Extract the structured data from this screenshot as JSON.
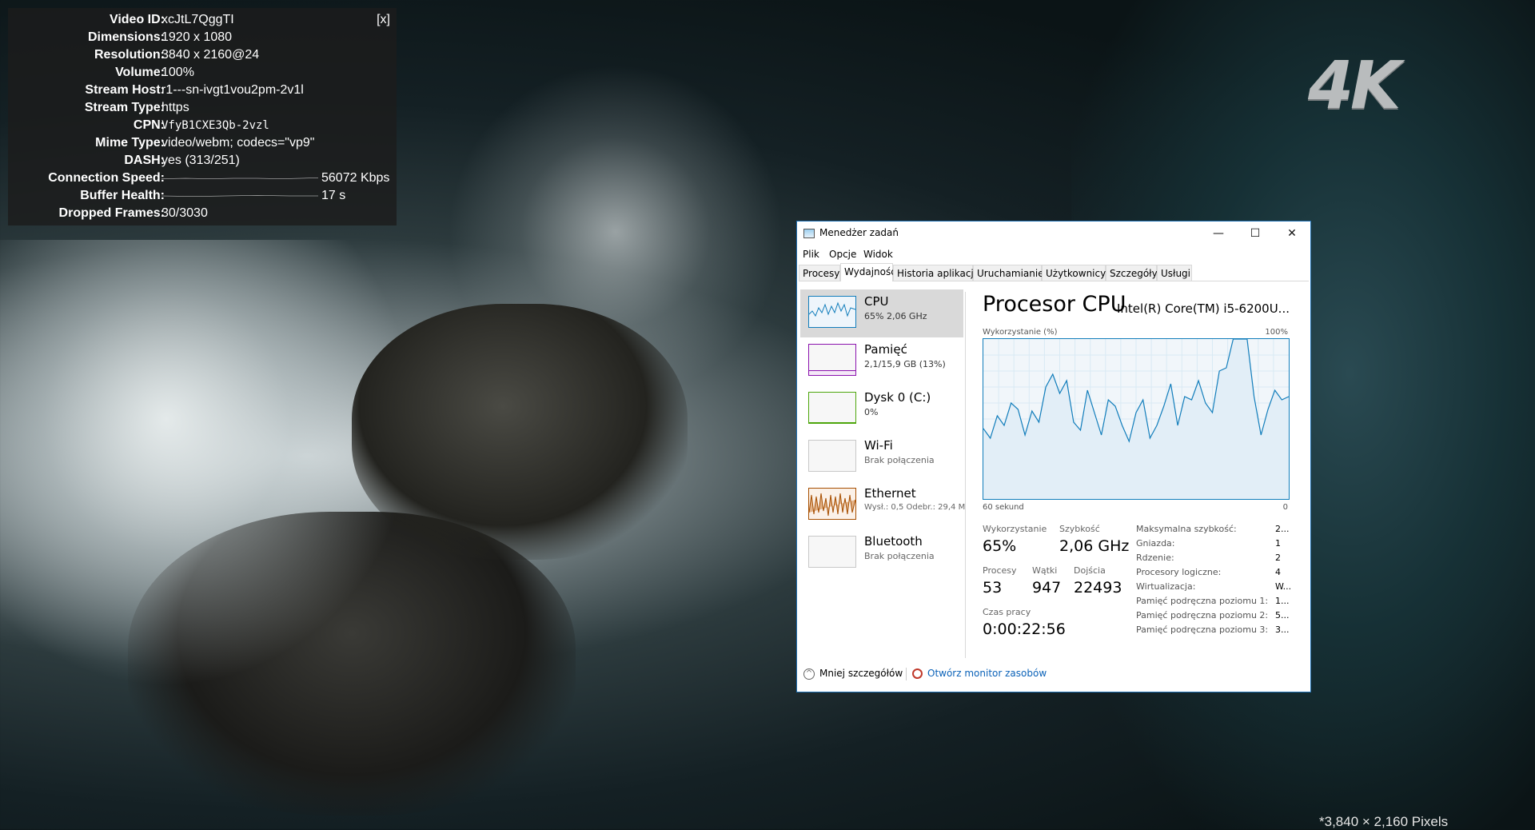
{
  "stats": {
    "close_label": "[x]",
    "rows": [
      {
        "key": "Video ID:",
        "value": "xcJtL7QggTI"
      },
      {
        "key": "Dimensions:",
        "value": "1920 x 1080"
      },
      {
        "key": "Resolution:",
        "value": "3840 x 2160@24"
      },
      {
        "key": "Volume:",
        "value": "100%"
      },
      {
        "key": "Stream Host:",
        "value": "r1---sn-ivgt1vou2pm-2v1l"
      },
      {
        "key": "Stream Type:",
        "value": "https"
      },
      {
        "key": "CPN:",
        "value": "VfyB1CXE3Qb-2vzl"
      },
      {
        "key": "Mime Type:",
        "value": "video/webm; codecs=\"vp9\""
      },
      {
        "key": "DASH:",
        "value": "yes (313/251)"
      },
      {
        "key": "Connection Speed:",
        "value": "56072 Kbps"
      },
      {
        "key": "Buffer Health:",
        "value": "17 s"
      },
      {
        "key": "Dropped Frames:",
        "value": "30/3030"
      }
    ]
  },
  "overlay": {
    "logo": "4K",
    "pixels_note": "*3,840 × 2,160 Pixels"
  },
  "taskmanager": {
    "title": "Menedżer zadań",
    "window_buttons": {
      "minimize": "—",
      "maximize": "☐",
      "close": "✕"
    },
    "menu": [
      "Plik",
      "Opcje",
      "Widok"
    ],
    "tabs": [
      "Procesy",
      "Wydajność",
      "Historia aplikacji",
      "Uruchamianie",
      "Użytkownicy",
      "Szczegóły",
      "Usługi"
    ],
    "active_tab": "Wydajność",
    "resources": [
      {
        "name": "CPU",
        "sub": "65%  2,06 GHz",
        "color": "#117dbb",
        "selected": true
      },
      {
        "name": "Pamięć",
        "sub": "2,1/15,9 GB (13%)",
        "color": "#8b12ae",
        "selected": false
      },
      {
        "name": "Dysk 0 (C:)",
        "sub": "0%",
        "color": "#4da60c",
        "selected": false
      },
      {
        "name": "Wi-Fi",
        "sub": "Brak połączenia",
        "color": "#a74f01",
        "selected": false
      },
      {
        "name": "Ethernet",
        "sub": "Wysł.: 0,5  Odebr.: 29,4 M",
        "color": "#a74f01",
        "selected": false
      },
      {
        "name": "Bluetooth",
        "sub": "Brak połączenia",
        "color": "#a74f01",
        "selected": false
      }
    ],
    "cpu": {
      "title": "Procesor CPU",
      "model": "Intel(R) Core(TM) i5-6200U...",
      "graph_label_left": "Wykorzystanie (%)",
      "graph_label_right": "100%",
      "time_left": "60 sekund",
      "time_right": "0",
      "history_percent": [
        44,
        38,
        52,
        46,
        60,
        56,
        40,
        55,
        48,
        70,
        78,
        66,
        74,
        48,
        43,
        68,
        54,
        40,
        62,
        58,
        46,
        36,
        54,
        62,
        38,
        46,
        58,
        72,
        46,
        64,
        62,
        74,
        60,
        54,
        80,
        82,
        100,
        100,
        100,
        64,
        40,
        56,
        68,
        62,
        64
      ]
    },
    "stats": {
      "utilization_label": "Wykorzystanie",
      "utilization": "65%",
      "speed_label": "Szybkość",
      "speed": "2,06 GHz",
      "processes_label": "Procesy",
      "processes": "53",
      "threads_label": "Wątki",
      "threads": "947",
      "handles_label": "Dojścia",
      "handles": "22493",
      "uptime_label": "Czas pracy",
      "uptime": "0:00:22:56"
    },
    "specs": [
      {
        "label": "Maksymalna szybkość:",
        "value": "2..."
      },
      {
        "label": "Gniazda:",
        "value": "1"
      },
      {
        "label": "Rdzenie:",
        "value": "2"
      },
      {
        "label": "Procesory logiczne:",
        "value": "4"
      },
      {
        "label": "Wirtualizacja:",
        "value": "W..."
      },
      {
        "label": "Pamięć podręczna poziomu 1:",
        "value": "1..."
      },
      {
        "label": "Pamięć podręczna poziomu 2:",
        "value": "5..."
      },
      {
        "label": "Pamięć podręczna poziomu 3:",
        "value": "3..."
      }
    ],
    "footer": {
      "fewer_details": "Mniej szczegółów",
      "resource_monitor": "Otwórz monitor zasobów"
    }
  }
}
